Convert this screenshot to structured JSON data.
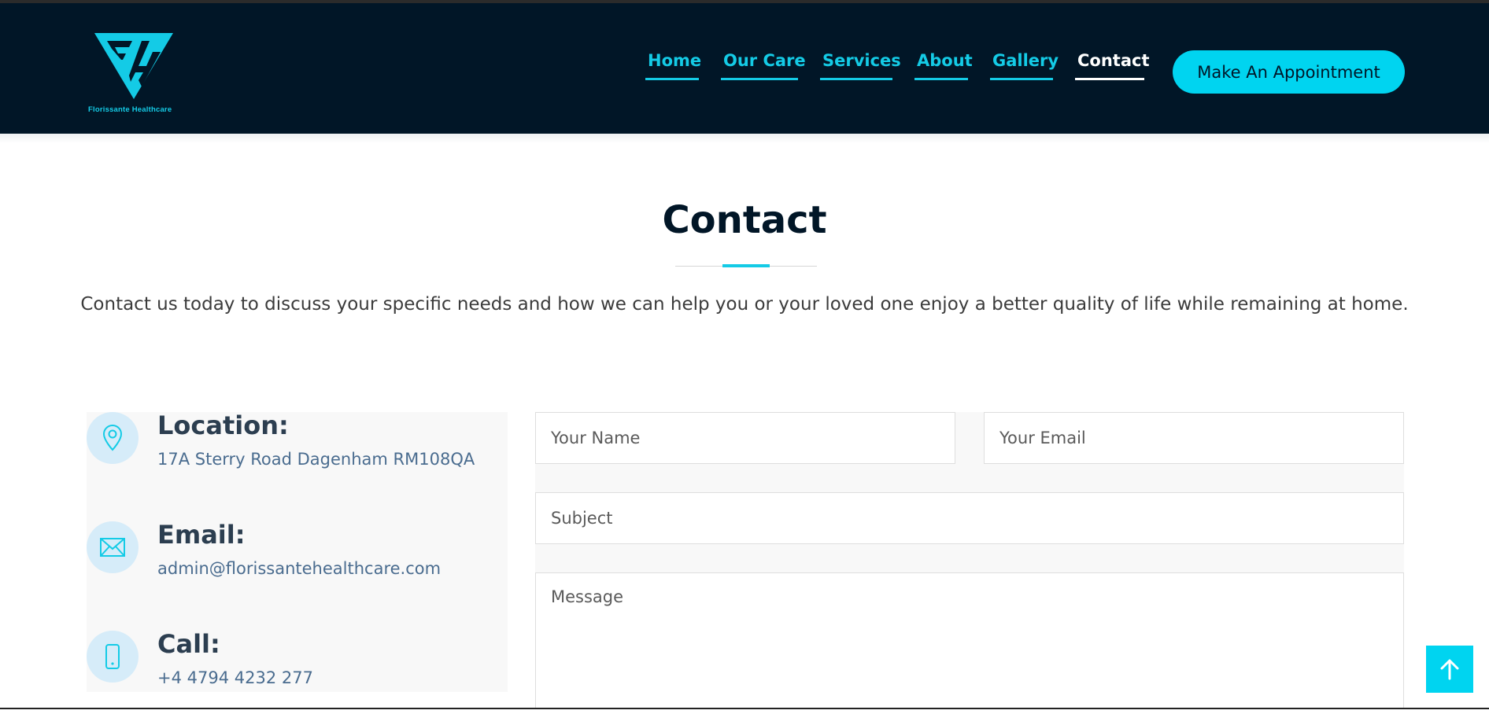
{
  "brand": {
    "name": "Florissante Healthcare",
    "accent_color": "#14cbe6",
    "header_bg": "#011627"
  },
  "nav": {
    "items": [
      {
        "label": "Home",
        "active": false
      },
      {
        "label": "Our Care",
        "active": false
      },
      {
        "label": "Services",
        "active": false
      },
      {
        "label": "About",
        "active": false
      },
      {
        "label": "Gallery",
        "active": false
      },
      {
        "label": "Contact",
        "active": true
      }
    ],
    "cta_label": "Make An Appointment"
  },
  "section": {
    "title": "Contact",
    "lead": "Contact us today to discuss your specific needs and how we can help you or your loved one enjoy a better quality of life while remaining at home."
  },
  "info": [
    {
      "icon": "location-pin-icon",
      "heading": "Location:",
      "value": "17A Sterry Road Dagenham RM108QA"
    },
    {
      "icon": "envelope-icon",
      "heading": "Email:",
      "value": "admin@florissantehealthcare.com"
    },
    {
      "icon": "phone-icon",
      "heading": "Call:",
      "value": "+4 4794 4232 277"
    }
  ],
  "form": {
    "name_placeholder": "Your Name",
    "email_placeholder": "Your Email",
    "subject_placeholder": "Subject",
    "message_placeholder": "Message"
  },
  "scroll_top_icon": "arrow-up-icon"
}
